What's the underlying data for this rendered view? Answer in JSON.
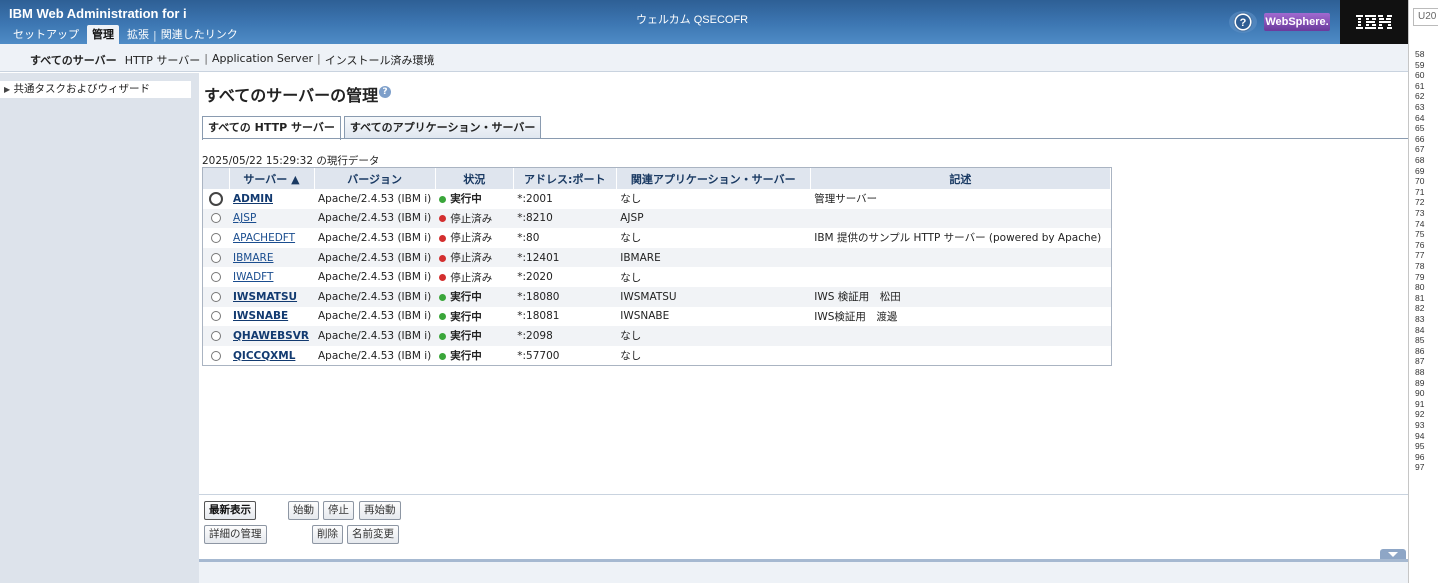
{
  "header": {
    "app_title": "IBM Web Administration for i",
    "welcome": "ウェルカム QSECOFR",
    "websphere": "WebSphere.",
    "ibm_logo": "IBM",
    "nav": [
      {
        "label": "セットアップ",
        "active": false
      },
      {
        "label": "管理",
        "active": true
      },
      {
        "label": "拡張",
        "active": false
      },
      {
        "label": "関連したリンク",
        "active": false
      }
    ]
  },
  "subnav": {
    "items": [
      "すべてのサーバー",
      "HTTP サーバー",
      "Application Server",
      "インストール済み環境"
    ]
  },
  "leftnav": {
    "item": "共通タスクおよびウィザード"
  },
  "main": {
    "title": "すべてのサーバーの管理",
    "tabs": [
      "すべての HTTP サーバー",
      "すべてのアプリケーション・サーバー"
    ],
    "data_time": "2025/05/22 15:29:32 の現行データ",
    "columns": {
      "server": "サーバー ▲",
      "version": "バージョン",
      "status": "状況",
      "address": "アドレス:ポート",
      "app_server": "関連アプリケーション・サーバー",
      "description": "記述"
    },
    "rows": [
      {
        "server": "ADMIN",
        "version": "Apache/2.4.53 (IBM i)",
        "status": "実行中",
        "address": "*:2001",
        "app_server": "なし",
        "description": "管理サーバー"
      },
      {
        "server": "AJSP",
        "version": "Apache/2.4.53 (IBM i)",
        "status": "停止済み",
        "address": "*:8210",
        "app_server": "AJSP",
        "description": ""
      },
      {
        "server": "APACHEDFT",
        "version": "Apache/2.4.53 (IBM i)",
        "status": "停止済み",
        "address": "*:80",
        "app_server": "なし",
        "description": "IBM 提供のサンプル HTTP サーバー (powered by Apache)"
      },
      {
        "server": "IBMARE",
        "version": "Apache/2.4.53 (IBM i)",
        "status": "停止済み",
        "address": "*:12401",
        "app_server": "IBMARE",
        "description": ""
      },
      {
        "server": "IWADFT",
        "version": "Apache/2.4.53 (IBM i)",
        "status": "停止済み",
        "address": "*:2020",
        "app_server": "なし",
        "description": ""
      },
      {
        "server": "IWSMATSU",
        "version": "Apache/2.4.53 (IBM i)",
        "status": "実行中",
        "address": "*:18080",
        "app_server": "IWSMATSU",
        "description": "IWS 検証用　松田"
      },
      {
        "server": "IWSNABE",
        "version": "Apache/2.4.53 (IBM i)",
        "status": "実行中",
        "address": "*:18081",
        "app_server": "IWSNABE",
        "description": "IWS検証用　渡邊"
      },
      {
        "server": "QHAWEBSVR",
        "version": "Apache/2.4.53 (IBM i)",
        "status": "実行中",
        "address": "*:2098",
        "app_server": "なし",
        "description": ""
      },
      {
        "server": "QICCQXML",
        "version": "Apache/2.4.53 (IBM i)",
        "status": "実行中",
        "address": "*:57700",
        "app_server": "なし",
        "description": ""
      }
    ],
    "buttons": {
      "refresh": "最新表示",
      "start": "始動",
      "stop": "停止",
      "restart": "再始動",
      "details": "詳細の管理",
      "delete": "削除",
      "rename": "名前変更"
    }
  },
  "ruler": {
    "input_value": "U20",
    "lines": [
      "58",
      "59",
      "60",
      "61",
      "62",
      "63",
      "64",
      "65",
      "66",
      "67",
      "68",
      "69",
      "70",
      "71",
      "72",
      "73",
      "74",
      "75",
      "76",
      "77",
      "78",
      "79",
      "80",
      "81",
      "82",
      "83",
      "84",
      "85",
      "86",
      "87",
      "88",
      "89",
      "90",
      "91",
      "92",
      "93",
      "94",
      "95",
      "96",
      "97"
    ]
  },
  "colors": {
    "running": "#3aa63a",
    "stopped": "#d32f2f",
    "header_blue": "#3d77b3",
    "table_header": "#dfe5ee"
  }
}
